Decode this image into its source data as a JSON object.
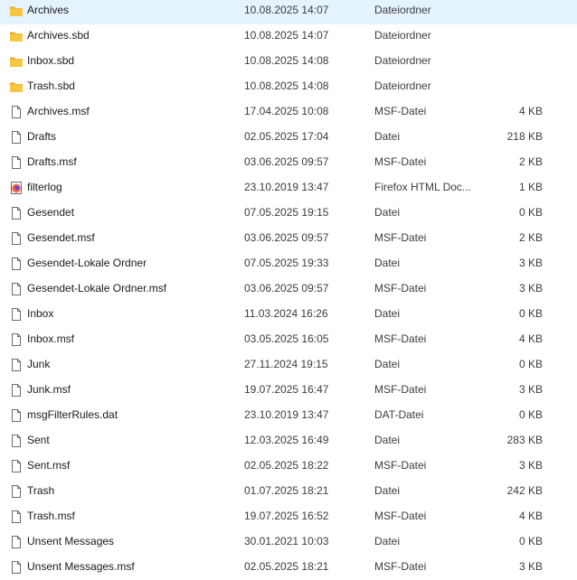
{
  "files": [
    {
      "name": "Archives",
      "date": "10.08.2025 14:07",
      "type": "Dateiordner",
      "size": "",
      "icon": "folder-icon"
    },
    {
      "name": "Archives.sbd",
      "date": "10.08.2025 14:07",
      "type": "Dateiordner",
      "size": "",
      "icon": "folder-icon"
    },
    {
      "name": "Inbox.sbd",
      "date": "10.08.2025 14:08",
      "type": "Dateiordner",
      "size": "",
      "icon": "folder-icon"
    },
    {
      "name": "Trash.sbd",
      "date": "10.08.2025 14:08",
      "type": "Dateiordner",
      "size": "",
      "icon": "folder-icon"
    },
    {
      "name": "Archives.msf",
      "date": "17.04.2025 10:08",
      "type": "MSF-Datei",
      "size": "4 KB",
      "icon": "file-icon"
    },
    {
      "name": "Drafts",
      "date": "02.05.2025 17:04",
      "type": "Datei",
      "size": "218 KB",
      "icon": "file-icon"
    },
    {
      "name": "Drafts.msf",
      "date": "03.06.2025 09:57",
      "type": "MSF-Datei",
      "size": "2 KB",
      "icon": "file-icon"
    },
    {
      "name": "filterlog",
      "date": "23.10.2019 13:47",
      "type": "Firefox HTML Doc...",
      "size": "1 KB",
      "icon": "firefox-html-icon"
    },
    {
      "name": "Gesendet",
      "date": "07.05.2025 19:15",
      "type": "Datei",
      "size": "0 KB",
      "icon": "file-icon"
    },
    {
      "name": "Gesendet.msf",
      "date": "03.06.2025 09:57",
      "type": "MSF-Datei",
      "size": "2 KB",
      "icon": "file-icon"
    },
    {
      "name": "Gesendet-Lokale Ordner",
      "date": "07.05.2025 19:33",
      "type": "Datei",
      "size": "3 KB",
      "icon": "file-icon"
    },
    {
      "name": "Gesendet-Lokale Ordner.msf",
      "date": "03.06.2025 09:57",
      "type": "MSF-Datei",
      "size": "3 KB",
      "icon": "file-icon"
    },
    {
      "name": "Inbox",
      "date": "11.03.2024 16:26",
      "type": "Datei",
      "size": "0 KB",
      "icon": "file-icon"
    },
    {
      "name": "Inbox.msf",
      "date": "03.05.2025 16:05",
      "type": "MSF-Datei",
      "size": "4 KB",
      "icon": "file-icon"
    },
    {
      "name": "Junk",
      "date": "27.11.2024 19:15",
      "type": "Datei",
      "size": "0 KB",
      "icon": "file-icon"
    },
    {
      "name": "Junk.msf",
      "date": "19.07.2025 16:47",
      "type": "MSF-Datei",
      "size": "3 KB",
      "icon": "file-icon"
    },
    {
      "name": "msgFilterRules.dat",
      "date": "23.10.2019 13:47",
      "type": "DAT-Datei",
      "size": "0 KB",
      "icon": "file-icon"
    },
    {
      "name": "Sent",
      "date": "12.03.2025 16:49",
      "type": "Datei",
      "size": "283 KB",
      "icon": "file-icon"
    },
    {
      "name": "Sent.msf",
      "date": "02.05.2025 18:22",
      "type": "MSF-Datei",
      "size": "3 KB",
      "icon": "file-icon"
    },
    {
      "name": "Trash",
      "date": "01.07.2025 18:21",
      "type": "Datei",
      "size": "242 KB",
      "icon": "file-icon"
    },
    {
      "name": "Trash.msf",
      "date": "19.07.2025 16:52",
      "type": "MSF-Datei",
      "size": "4 KB",
      "icon": "file-icon"
    },
    {
      "name": "Unsent Messages",
      "date": "30.01.2021 10:03",
      "type": "Datei",
      "size": "0 KB",
      "icon": "file-icon"
    },
    {
      "name": "Unsent Messages.msf",
      "date": "02.05.2025 18:21",
      "type": "MSF-Datei",
      "size": "3 KB",
      "icon": "file-icon"
    }
  ],
  "colors": {
    "folder": "#F7C744",
    "folder_dark": "#E3A92B",
    "file_outline": "#6b6b6b",
    "firefox_orange": "#FF7139",
    "firefox_purple": "#7542E5"
  }
}
